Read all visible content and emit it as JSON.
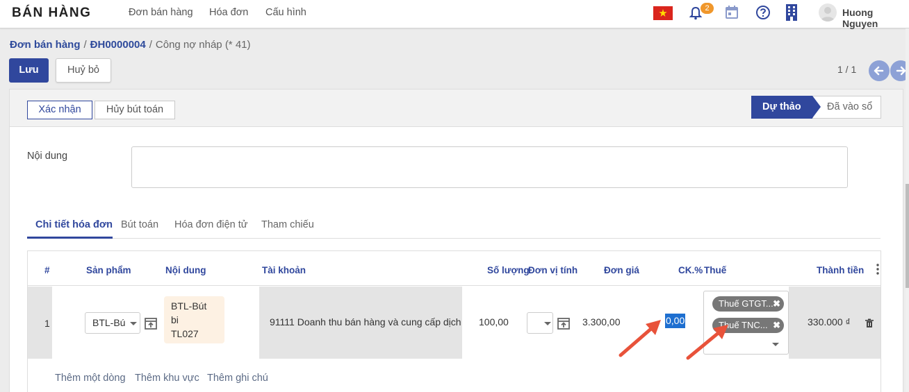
{
  "app": {
    "title": "BÁN HÀNG"
  },
  "menu": [
    "Đơn bán hàng",
    "Hóa đơn",
    "Cấu hình"
  ],
  "notifications": {
    "count": "2"
  },
  "user": {
    "name": "Huong Nguyen"
  },
  "breadcrumb": {
    "root": "Đơn bán hàng",
    "record": "ĐH0000004",
    "current": "Công nợ nháp (* 41)",
    "sep": "/"
  },
  "actions": {
    "save": "Lưu",
    "discard": "Huỷ bỏ"
  },
  "pager": {
    "value": "1 / 1"
  },
  "header_buttons": {
    "confirm": "Xác nhận",
    "cancel_entry": "Hủy bút toán"
  },
  "stages": {
    "draft": "Dự thảo",
    "posted": "Đã vào sổ"
  },
  "form": {
    "content_label": "Nội dung",
    "content_value": ""
  },
  "tabs": [
    "Chi tiết hóa đơn",
    "Bút toán",
    "Hóa đơn điện tử",
    "Tham chiếu"
  ],
  "columns": [
    "#",
    "Sản phẩm",
    "Nội dung",
    "Tài khoản",
    "Số lượng",
    "Đơn vị tính",
    "Đơn giá",
    "CK.%",
    "Thuế",
    "Thành tiền"
  ],
  "rows": [
    {
      "index": "1",
      "product": "BTL-Bú",
      "content_lines": [
        "BTL-Bút",
        "bi",
        "TL027"
      ],
      "account": "91111 Doanh thu bán hàng và cung cấp dịch",
      "quantity": "100,00",
      "unit": "",
      "unit_price": "3.300,00",
      "discount": "0,00",
      "taxes": [
        "Thuế GTGT...",
        "Thuế TNC..."
      ],
      "amount": "330.000 ₫"
    }
  ],
  "row_actions": [
    "Thêm một dòng",
    "Thêm khu vực",
    "Thêm ghi chú"
  ],
  "colors": {
    "primary": "#30479d",
    "annotation_arrow": "#e8523a",
    "selection": "#1e6fd0",
    "tag": "#777777"
  }
}
